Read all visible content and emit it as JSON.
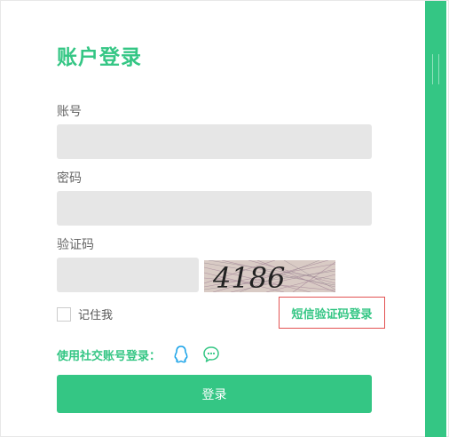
{
  "form": {
    "title": "账户登录",
    "username_label": "账号",
    "username_value": "",
    "password_label": "密码",
    "password_value": "",
    "captcha_label": "验证码",
    "captcha_value": "",
    "captcha_text": "4186",
    "remember_label": "记住我",
    "sms_login_label": "短信验证码登录",
    "social_label": "使用社交账号登录：",
    "submit_label": "登录"
  },
  "icons": {
    "qq": "qq-icon",
    "wechat": "wechat-icon"
  },
  "colors": {
    "accent": "#34c684",
    "input_bg": "#e6e6e6",
    "sms_border": "#e35353"
  }
}
